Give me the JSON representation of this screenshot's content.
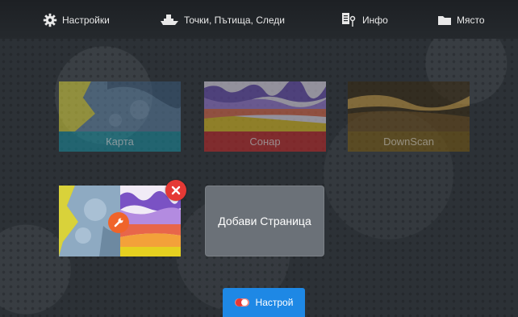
{
  "top_menu": {
    "settings": {
      "label": "Настройки",
      "icon": "gear-icon"
    },
    "waypoints": {
      "label": "Точки, Пътища, Следи",
      "icon": "boat-icon"
    },
    "info": {
      "label": "Инфо",
      "icon": "info-icon"
    },
    "storage": {
      "label": "Място",
      "icon": "folder-icon"
    }
  },
  "pages": [
    {
      "label": "Карта",
      "accent": "#1a8fa0"
    },
    {
      "label": "Сонар",
      "accent": "#c62828"
    },
    {
      "label": "DownScan",
      "accent": "#7a5a10"
    }
  ],
  "add_page": {
    "label": "Добави Страница"
  },
  "customize": {
    "label": "Настрой"
  }
}
